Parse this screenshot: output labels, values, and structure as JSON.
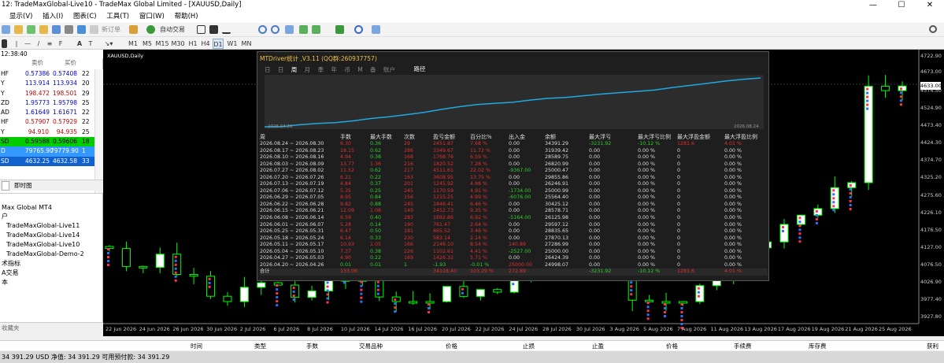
{
  "window": {
    "title": "12: TradeMaxGlobal-Live10 - TradeMax Global Limited - [XAUUSD,Daily]"
  },
  "menu": [
    "显示(V)",
    "插入(I)",
    "图表(C)",
    "工具(T)",
    "窗口(W)",
    "帮助(H)"
  ],
  "toolbar": {
    "new_order": "新订单",
    "auto_trade": "自动交易"
  },
  "timeframes": [
    "M1",
    "M5",
    "M15",
    "M30",
    "H1",
    "H4",
    "D1",
    "W1",
    "MN"
  ],
  "market_watch": {
    "time": "12:38:40",
    "col_bid": "卖价",
    "col_ask": "买价",
    "rows": [
      {
        "sym": "HF",
        "bid": "0.57386",
        "ask": "0.57408",
        "spread": "22",
        "bg": "#ffffff",
        "color": "#0000cc"
      },
      {
        "sym": "Y",
        "bid": "113.914",
        "ask": "113.934",
        "spread": "20",
        "bg": "#ffffff",
        "color": "#0000cc"
      },
      {
        "sym": "Y",
        "bid": "198.472",
        "ask": "198.501",
        "spread": "29",
        "bg": "#ffffff",
        "color": "#cc0000"
      },
      {
        "sym": "ZD",
        "bid": "1.95773",
        "ask": "1.95798",
        "spread": "25",
        "bg": "#ffffff",
        "color": "#0000cc"
      },
      {
        "sym": "AD",
        "bid": "1.61649",
        "ask": "1.61671",
        "spread": "22",
        "bg": "#ffffff",
        "color": "#0000cc"
      },
      {
        "sym": "HF",
        "bid": "0.57907",
        "ask": "0.57929",
        "spread": "22",
        "bg": "#ffffff",
        "color": "#cc0000"
      },
      {
        "sym": "Y",
        "bid": "94.910",
        "ask": "94.935",
        "spread": "25",
        "bg": "#ffffff",
        "color": "#cc0000"
      },
      {
        "sym": "SD",
        "bid": "0.59588",
        "ask": "0.59606",
        "spread": "18",
        "bg": "#00cc00",
        "color": "#000000"
      },
      {
        "sym": "D",
        "bid": "79765.90",
        "ask": "79779.90",
        "spread": "1",
        "bg": "#3399ff",
        "color": "#ffffff"
      },
      {
        "sym": "SD",
        "bid": "4632.25",
        "ask": "4632.58",
        "spread": "33",
        "bg": "#1060d0",
        "color": "#ffffff"
      }
    ],
    "tab": "即时图"
  },
  "navigator": {
    "items": [
      "Max Global MT4",
      "户",
      "TradeMaxGlobal-Live11",
      "TradeMaxGlobal-Live14",
      "TradeMaxGlobal-Live10",
      "TradeMaxGlobal-Demo-2",
      "术指标",
      "A交易",
      "本"
    ],
    "bottom": "收藏夹"
  },
  "chart": {
    "symbol": "XAUUSD,Daily",
    "current_price": "4633.00",
    "price_ticks": [
      "4722.90",
      "4673.00",
      "4574.50",
      "4524.90",
      "4473.40",
      "4424.30",
      "4374.70",
      "4325.20",
      "4275.60",
      "4226.10",
      "4176.50",
      "4127.00",
      "4076.50",
      "4026.90",
      "3977.40",
      "3927.80"
    ],
    "date_ticks": [
      "22 Jun 2026",
      "24 Jun 2026",
      "26 Jun 2026",
      "30 Jun 2026",
      "2 Jul 2026",
      "6 Jul 2026",
      "8 Jul 2026",
      "10 Jul 2026",
      "14 Jul 2026",
      "16 Jul 2026",
      "20 Jul 2026",
      "22 Jul 2026",
      "24 Jul 2026",
      "28 Jul 2026",
      "30 Jul 2026",
      "3 Aug 2026",
      "5 Aug 2026",
      "7 Aug 2026",
      "11 Aug 2026",
      "13 Aug 2026",
      "17 Aug 2026",
      "19 Aug 2026",
      "21 Aug 2026",
      "25 Aug 2026"
    ]
  },
  "stats_panel": {
    "title": "MTDriver统计 ,V3.11 (QQ群:260937757)",
    "tabs": [
      "日",
      "日",
      "周",
      "月",
      "季",
      "年",
      "币",
      "M",
      "备",
      "账户"
    ],
    "path_button": "路径",
    "equity_start": "2026.04.20",
    "equity_end": "2026.08.24",
    "headers": [
      "周",
      "手数",
      "最大手数",
      "次数",
      "盈亏金额",
      "百分比%",
      "出入金",
      "余额",
      "最大浮亏",
      "最大浮亏比例",
      "最大浮盈金额",
      "最大浮盈比例"
    ],
    "rows": [
      [
        "2026.08.24 ~ 2026.08.30",
        "6.30",
        "0.36",
        "29",
        "2451.87",
        "7.68 %",
        "0.00",
        "34391.29",
        "-3231.92",
        "-10.12 %",
        "1281.6",
        "4.01 %"
      ],
      [
        "2026.08.17 ~ 2026.08.23",
        "18.15",
        "0.62",
        "286",
        "3349.67",
        "11.72 %",
        "0.00",
        "31939.42",
        "0.00",
        "0.00 %",
        "0",
        "0.00 %"
      ],
      [
        "2026.08.10 ~ 2026.08.16",
        "4.94",
        "0.38",
        "168",
        "1768.76",
        "6.59 %",
        "0.00",
        "28589.75",
        "0.00",
        "0.00 %",
        "0",
        "0.00 %"
      ],
      [
        "2026.08.03 ~ 2026.08.09",
        "13.77",
        "1.36",
        "216",
        "1820.52",
        "7.28 %",
        "0.00",
        "26820.99",
        "0.00",
        "0.00 %",
        "0",
        "0.00 %"
      ],
      [
        "2026.07.27 ~ 2026.08.02",
        "11.52",
        "0.62",
        "217",
        "4511.61",
        "22.02 %",
        "-9367.00",
        "25000.47",
        "0.00",
        "0.00 %",
        "0",
        "0.00 %"
      ],
      [
        "2026.07.20 ~ 2026.07.26",
        "6.21",
        "0.22",
        "163",
        "3608.95",
        "13.75 %",
        "0.00",
        "29855.86",
        "0.00",
        "0.00 %",
        "0",
        "0.00 %"
      ],
      [
        "2026.07.13 ~ 2026.07.19",
        "4.84",
        "0.37",
        "201",
        "1245.92",
        "4.98 %",
        "0.00",
        "26246.91",
        "0.00",
        "0.00 %",
        "0",
        "0.00 %"
      ],
      [
        "2026.07.06 ~ 2026.07.12",
        "5.35",
        "0.25",
        "245",
        "1170.59",
        "4.91 %",
        "-1734.00",
        "25000.99",
        "0.00",
        "0.00 %",
        "0",
        "0.00 %"
      ],
      [
        "2026.06.29 ~ 2026.07.05",
        "8.95",
        "0.84",
        "156",
        "1215.25",
        "4.99 %",
        "-6076.00",
        "25564.40",
        "0.00",
        "0.00 %",
        "0",
        "0.00 %"
      ],
      [
        "2026.06.22 ~ 2026.06.28",
        "9.82",
        "0.88",
        "245",
        "1846.41",
        "6.46 %",
        "0.00",
        "30425.12",
        "0.00",
        "0.00 %",
        "0",
        "0.00 %"
      ],
      [
        "2026.06.15 ~ 2026.06.21",
        "12.09",
        "1.08",
        "149",
        "2452.73",
        "9.35 %",
        "0.00",
        "28578.71",
        "0.00",
        "0.00 %",
        "0",
        "0.00 %"
      ],
      [
        "2026.06.08 ~ 2026.06.14",
        "6.59",
        "0.40",
        "283",
        "1692.86",
        "6.92 %",
        "-5164.00",
        "26125.98",
        "0.00",
        "0.00 %",
        "0",
        "0.00 %"
      ],
      [
        "2026.06.01 ~ 2026.06.07",
        "5.28",
        "0.14",
        "190",
        "761.47",
        "2.64 %",
        "0.00",
        "29597.12",
        "0.00",
        "0.00 %",
        "0",
        "0.00 %"
      ],
      [
        "2026.05.25 ~ 2026.05.31",
        "6.47",
        "0.50",
        "181",
        "865.52",
        "3.46 %",
        "0.00",
        "28835.65",
        "0.00",
        "0.00 %",
        "0",
        "0.00 %"
      ],
      [
        "2026.05.18 ~ 2026.05.24",
        "6.14",
        "0.33",
        "230",
        "583.14",
        "2.14 %",
        "0.00",
        "27870.13",
        "0.00",
        "0.00 %",
        "0",
        "0.00 %"
      ],
      [
        "2026.05.11 ~ 2026.05.17",
        "10.93",
        "1.05",
        "166",
        "2146.10",
        "8.54 %",
        "140.89",
        "27286.99",
        "0.00",
        "0.00 %",
        "0",
        "0.00 %"
      ],
      [
        "2026.05.04 ~ 2026.05.10",
        "7.37",
        "0.38",
        "226",
        "1102.61",
        "4.41 %",
        "-2527.00",
        "25000.00",
        "0.00",
        "0.00 %",
        "0",
        "0.00 %"
      ],
      [
        "2026.04.27 ~ 2026.05.03",
        "4.90",
        "0.22",
        "169",
        "1426.32",
        "5.71 %",
        "0.00",
        "26424.39",
        "0.00",
        "0.00 %",
        "0",
        "0.00 %"
      ],
      [
        "2026.04.20 ~ 2026.04.26",
        "0.01",
        "0.01",
        "1",
        "-1.93",
        "-0.01 %",
        "25000.00",
        "24998.07",
        "0.00",
        "0.00 %",
        "0",
        "0.00 %"
      ]
    ],
    "summary": [
      "合计",
      "133.06",
      "",
      "",
      "34118.40",
      "103.29 %",
      "272.89",
      "",
      "-3231.92",
      "-10.12 %",
      "1281.6",
      "4.01 %"
    ],
    "equity_curve": [
      0,
      0.5,
      4.2,
      6.8,
      8.5,
      12.1,
      16.9,
      20.4,
      24.8,
      29.5,
      35.6,
      41.2,
      45.5,
      48.1,
      50.2,
      54.6,
      58.3,
      60.1,
      63.5,
      66.9,
      69.8,
      72.4,
      75.1,
      80.2,
      84.6,
      88.9,
      93.5,
      97.1,
      100
    ]
  },
  "terminal": {
    "columns": [
      "时间",
      "类型",
      "手数",
      "交易品种",
      "价格",
      "止损",
      "止盈",
      "价格",
      "手续费",
      "库存费",
      "获利"
    ]
  },
  "status": {
    "text": "34 391.29 USD  净值: 34 391.29  可用预付款: 34 391.29"
  }
}
